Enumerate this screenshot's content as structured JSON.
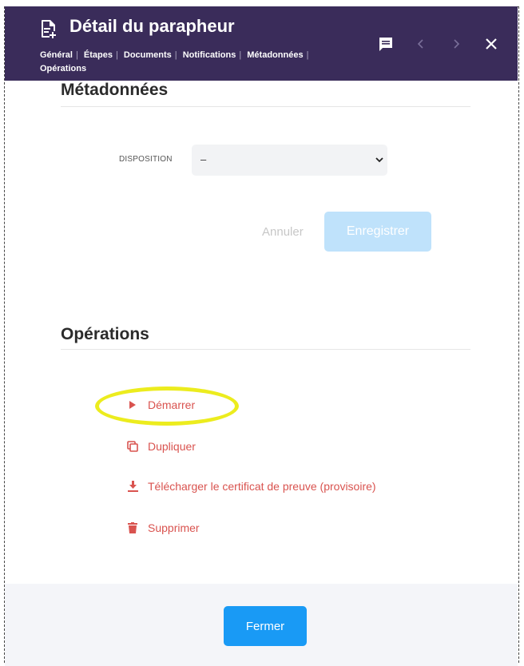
{
  "header": {
    "title": "Détail du parapheur",
    "tabs": [
      "Général",
      "Étapes",
      "Documents",
      "Notifications",
      "Métadonnées",
      "Opérations"
    ]
  },
  "metadata_section": {
    "title": "Métadonnées",
    "field_label": "DISPOSITION",
    "select_value": "–",
    "cancel_label": "Annuler",
    "save_label": "Enregistrer"
  },
  "operations_section": {
    "title": "Opérations",
    "items": [
      {
        "label": "Démarrer",
        "icon": "play-icon"
      },
      {
        "label": "Dupliquer",
        "icon": "duplicate-icon"
      },
      {
        "label": "Télécharger le certificat de preuve (provisoire)",
        "icon": "download-icon"
      },
      {
        "label": "Supprimer",
        "icon": "trash-icon"
      }
    ]
  },
  "footer": {
    "close_label": "Fermer"
  },
  "colors": {
    "header_bg": "#3a2c5a",
    "danger": "#d9534f",
    "primary": "#199af5",
    "primary_disabled": "#bfe2fb",
    "highlight": "#ecec1e"
  }
}
